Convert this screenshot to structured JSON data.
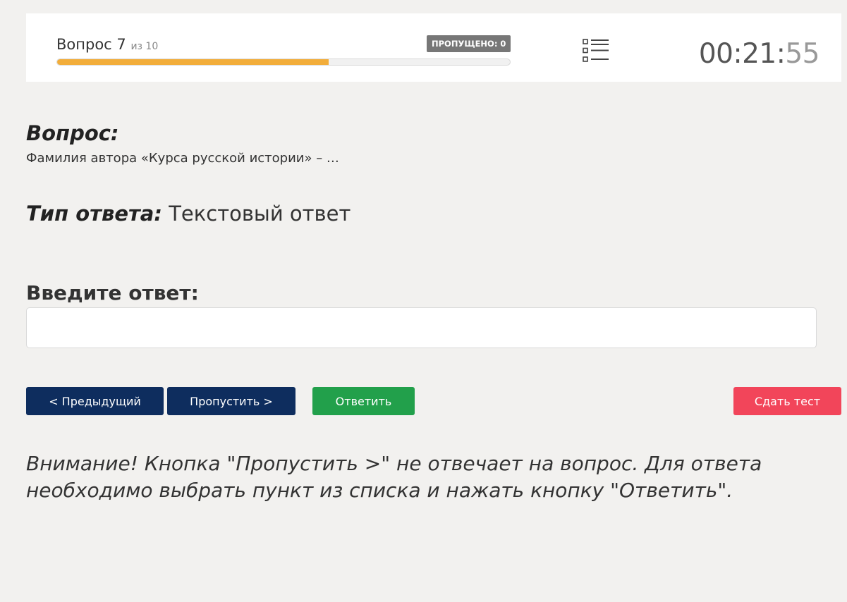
{
  "header": {
    "question_label": "Вопрос 7",
    "question_of": "из 10",
    "skipped_badge": "ПРОПУЩЕНО: 0",
    "progress": 0.6,
    "colors": {
      "progress_fill": "#f2ad3a",
      "badge": "#777777"
    },
    "timer_main": "00:21:",
    "timer_seconds": "55"
  },
  "question": {
    "heading": "Вопрос:",
    "text": "Фамилия автора «Курса русской истории» – …"
  },
  "answer_type": {
    "label": "Тип ответа:",
    "value": "Текстовый ответ"
  },
  "answer": {
    "label": "Введите ответ:",
    "value": "",
    "placeholder": ""
  },
  "buttons": {
    "prev": "< Предыдущий",
    "skip": "Пропустить >",
    "answer": "Ответить",
    "submit": "Сдать тест",
    "colors": {
      "nav": "#0e2d5e",
      "answer": "#22a04b",
      "submit": "#f2455a"
    }
  },
  "notice": "Внимание! Кнопка \"Пропустить >\" не отвечает на вопрос. Для ответа необходимо выбрать пункт из списка и нажать кнопку \"Ответить\"."
}
